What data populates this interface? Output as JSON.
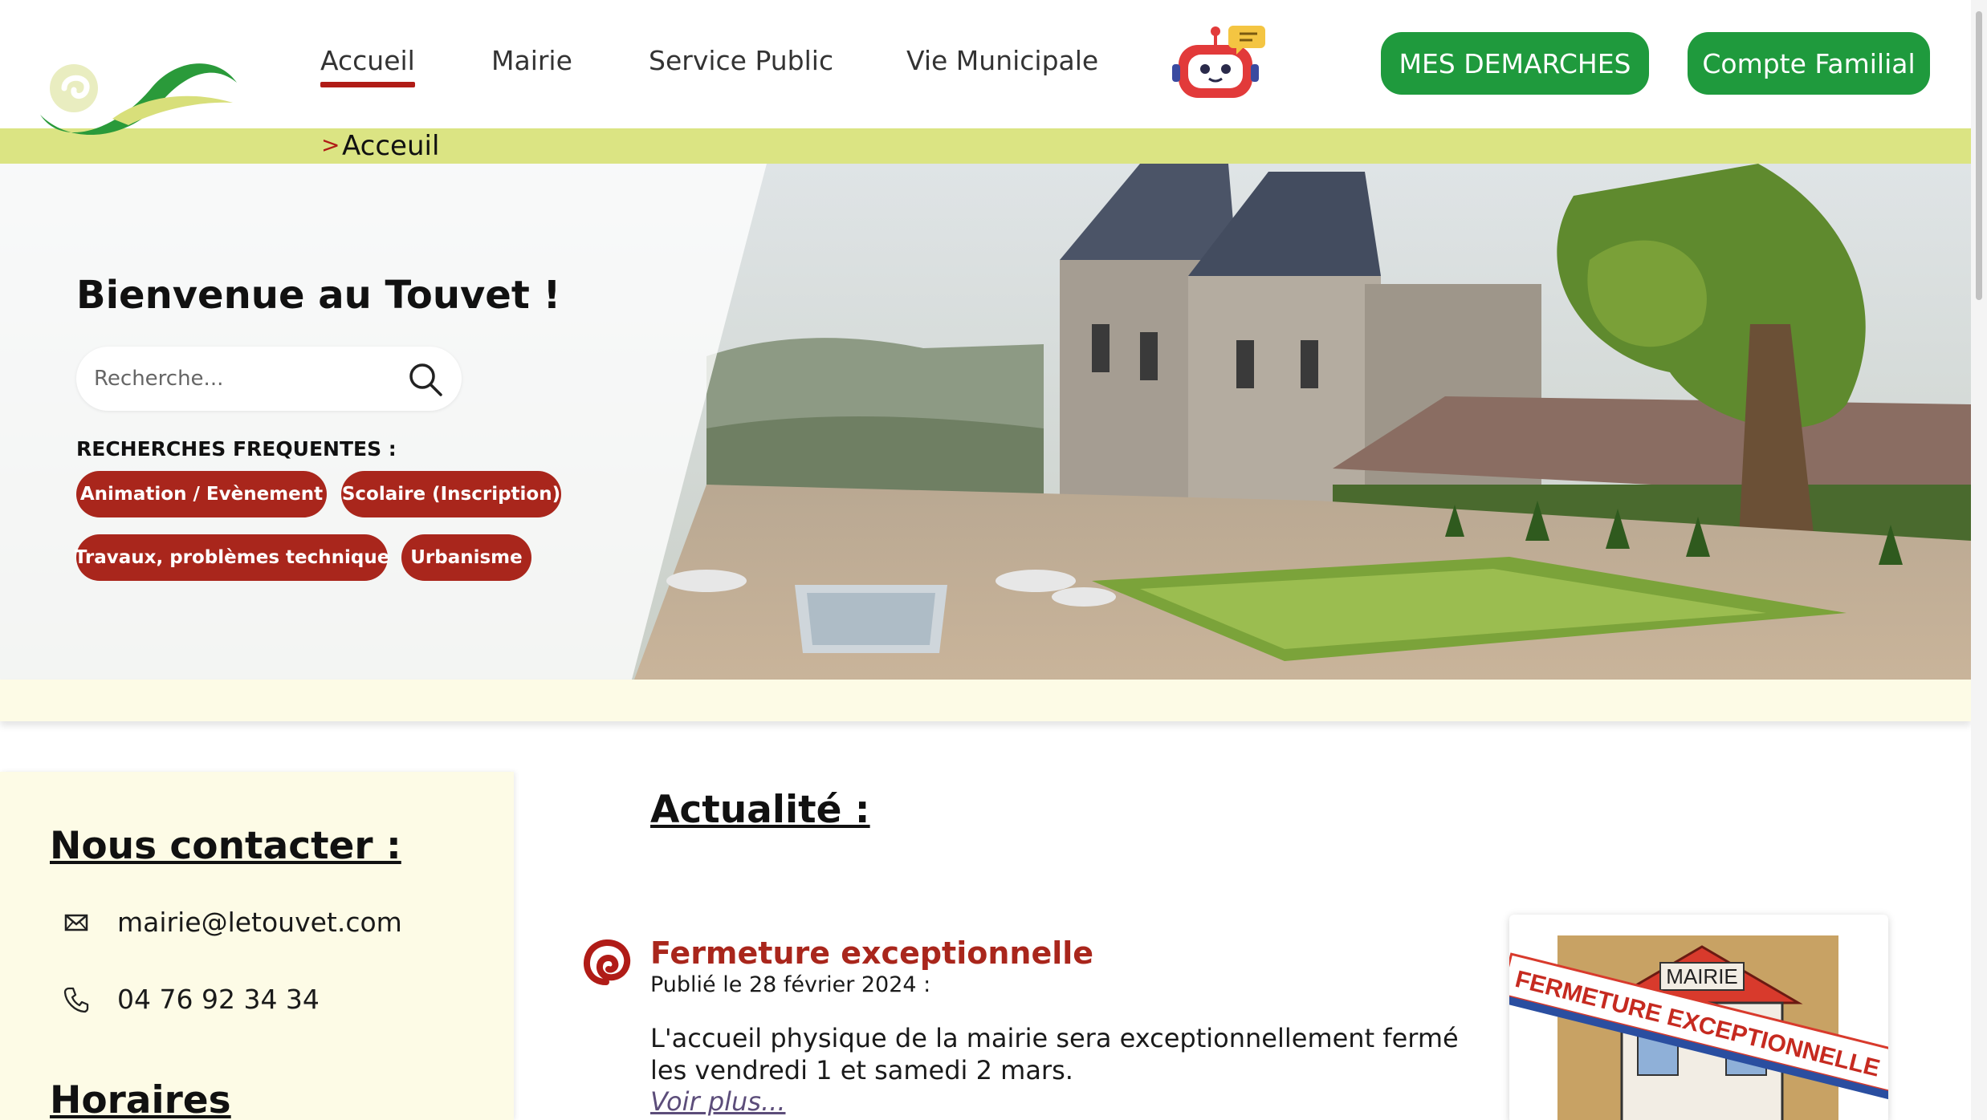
{
  "header": {
    "nav": [
      "Accueil",
      "Mairie",
      "Service Public",
      "Vie Municipale"
    ],
    "active_nav": "Accueil",
    "buttons": {
      "demarches": "MES DEMARCHES",
      "compte": "Compte Familial"
    }
  },
  "breadcrumb": {
    "separator": ">",
    "current": "Acceuil"
  },
  "hero": {
    "title": "Bienvenue au Touvet !",
    "search_placeholder": "Recherche...",
    "frequent_label": "RECHERCHES FREQUENTES :",
    "tags": [
      "Animation / Evènement",
      "Scolaire (Inscription)",
      "Travaux, problèmes technique",
      "Urbanisme"
    ]
  },
  "contact": {
    "title": "Nous contacter :",
    "email": "mairie@letouvet.com",
    "phone": "04 76 92 34 34",
    "hours_title": "Horaires"
  },
  "news": {
    "heading": "Actualité :",
    "items": [
      {
        "title": "Fermeture exceptionnelle",
        "date": "Publié le 28 février 2024 :",
        "body": "L'accueil physique de la mairie sera exceptionnellement fermé les vendredi 1 et samedi 2 mars.",
        "more": "Voir plus...",
        "image_sign": "MAIRIE",
        "image_banner": "FERMETURE EXCEPTIONNELLE"
      }
    ]
  },
  "colors": {
    "brand_green": "#1f9a3d",
    "accent_red": "#a9261c",
    "breadcrumb_bg": "#dbe483",
    "panel_bg": "#fdfbe6"
  }
}
